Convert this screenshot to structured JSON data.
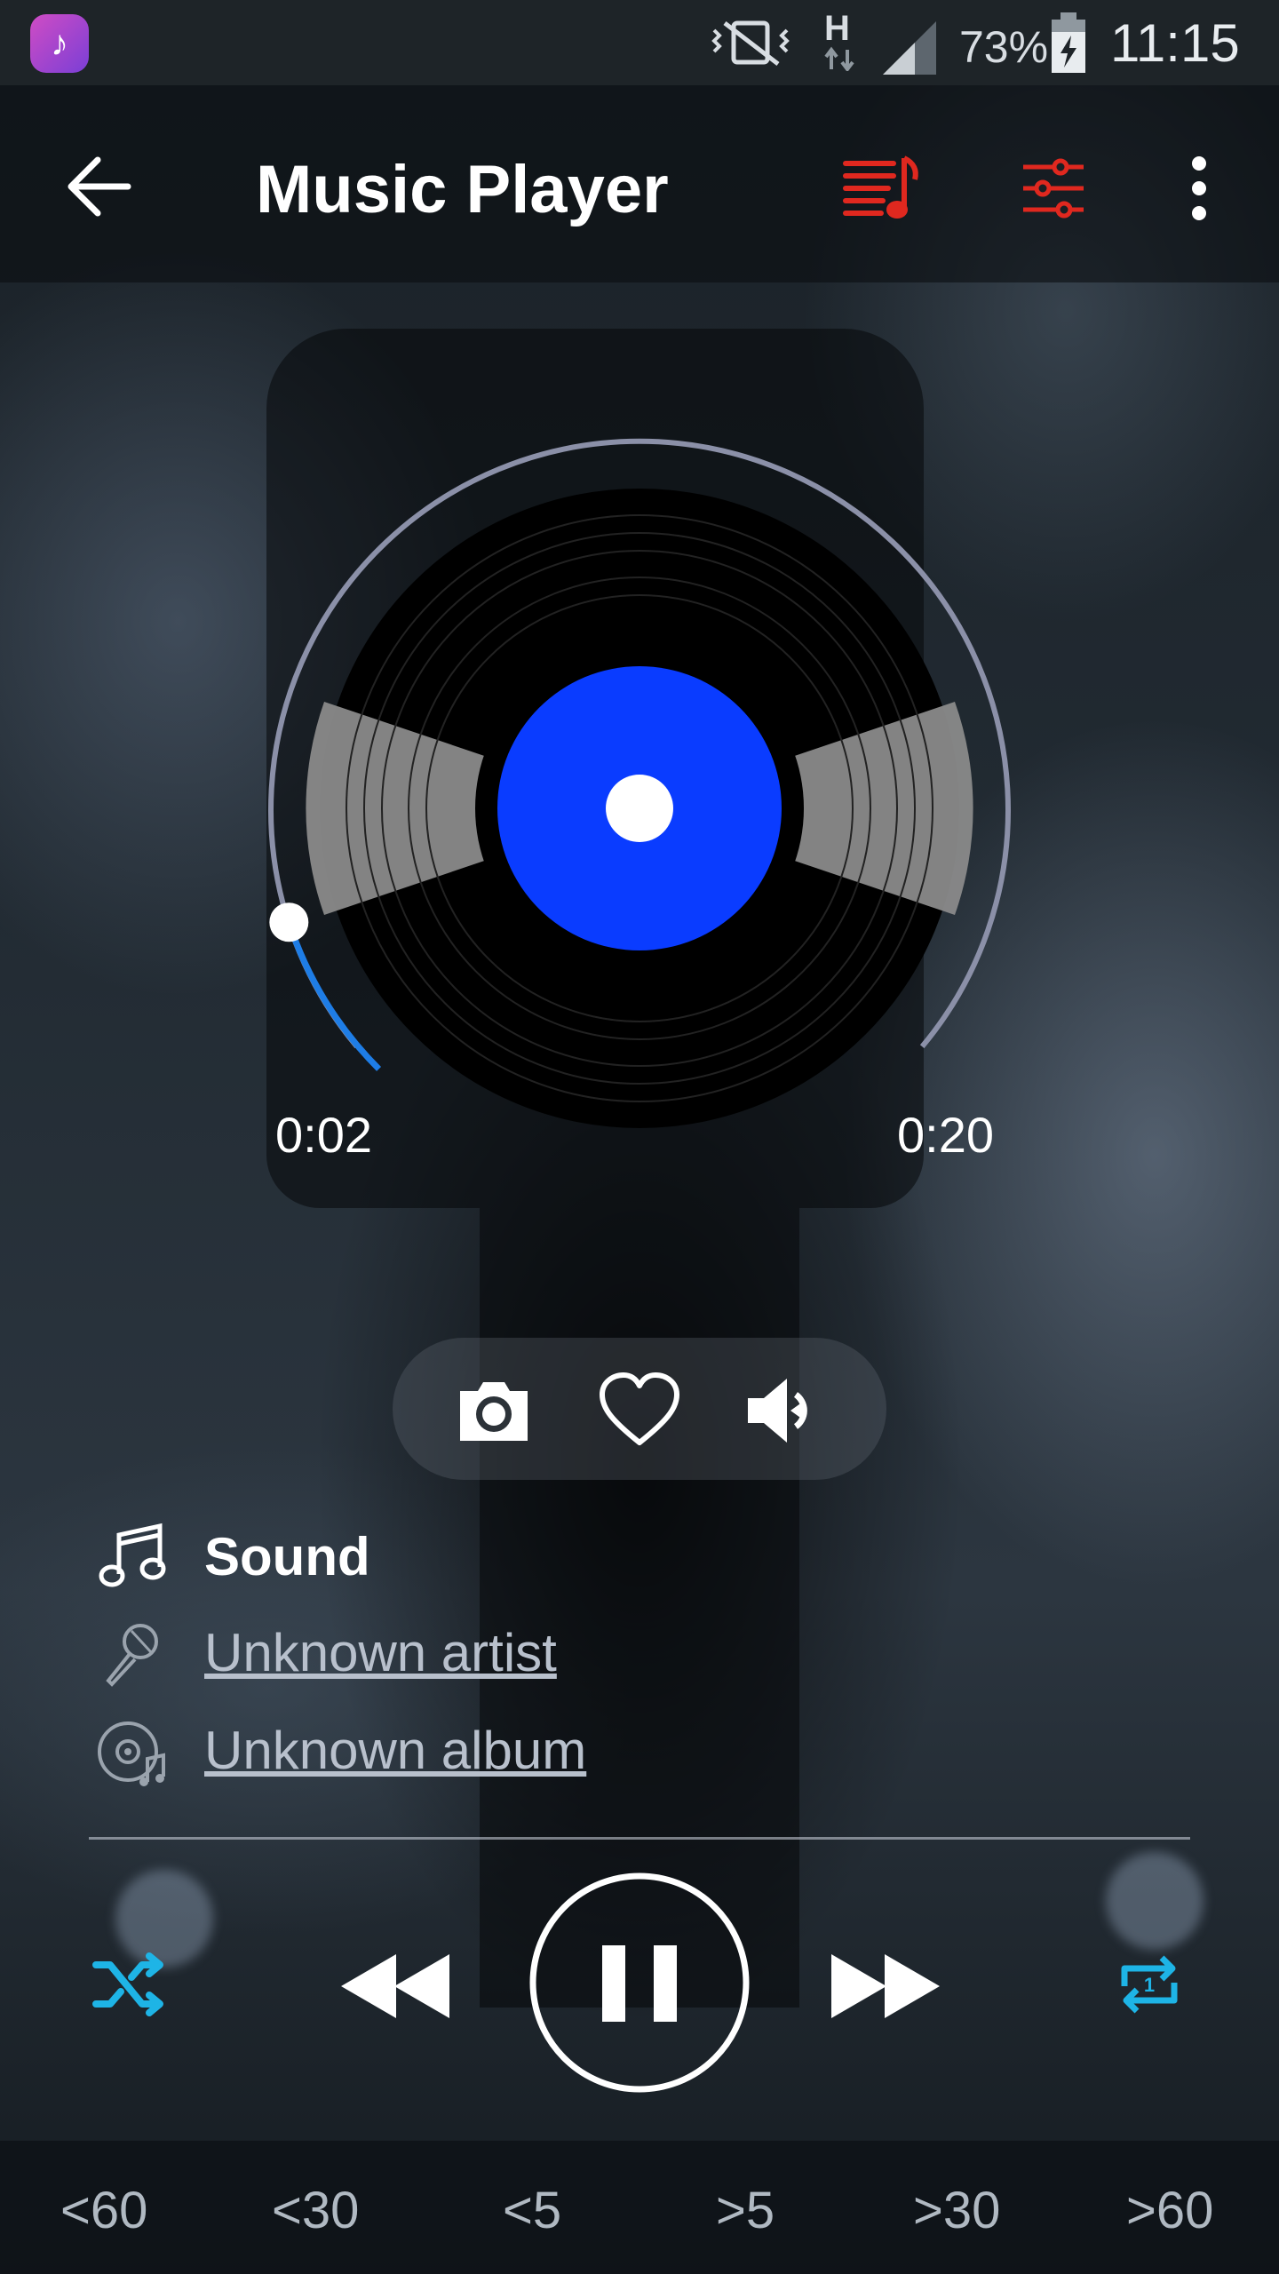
{
  "status_bar": {
    "network_type": "H",
    "battery_percent": "73%",
    "time": "11:15",
    "app_icon": "music-note-icon",
    "icons": [
      "vibrate-icon",
      "data-arrows-icon",
      "signal-icon",
      "battery-charging-icon"
    ]
  },
  "app_bar": {
    "title": "Music Player",
    "icons": [
      "back-arrow-icon",
      "playlist-icon",
      "equalizer-icon",
      "more-vert-icon"
    ],
    "accent_color": "#e0281f"
  },
  "player": {
    "elapsed": "0:02",
    "duration": "0:20",
    "progress_fraction": 0.1,
    "progress_color": "#1e7de6",
    "label_color": "#0a3cff"
  },
  "actions": {
    "icons": [
      "camera-icon",
      "heart-icon",
      "volume-icon"
    ]
  },
  "track": {
    "title": "Sound",
    "artist": "Unknown artist",
    "album": "Unknown album"
  },
  "controls": {
    "shuffle_color": "#1eb4e6",
    "icons": [
      "shuffle-icon",
      "rewind-icon",
      "pause-icon",
      "fast-forward-icon",
      "repeat-one-icon"
    ],
    "repeat_badge": "1"
  },
  "jump_buttons": [
    "<60",
    "<30",
    "<5",
    ">5",
    ">30",
    ">60"
  ]
}
